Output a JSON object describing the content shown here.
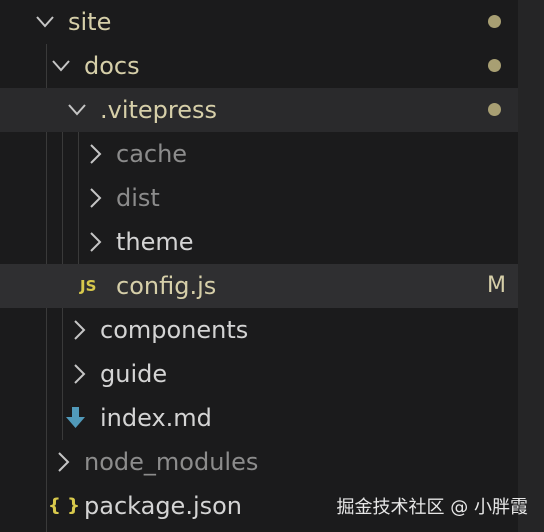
{
  "explorer": {
    "items": [
      {
        "label": "site",
        "type": "folder",
        "state": "expanded",
        "color": "#d6cfa9",
        "decoration": "dot"
      },
      {
        "label": "docs",
        "type": "folder",
        "state": "expanded",
        "color": "#d6cfa9",
        "decoration": "dot"
      },
      {
        "label": ".vitepress",
        "type": "folder",
        "state": "expanded",
        "color": "#d6cfa9",
        "decoration": "dot"
      },
      {
        "label": "cache",
        "type": "folder",
        "state": "collapsed",
        "color": "#8c8c8c"
      },
      {
        "label": "dist",
        "type": "folder",
        "state": "collapsed",
        "color": "#8c8c8c"
      },
      {
        "label": "theme",
        "type": "folder",
        "state": "collapsed",
        "color": "#d4d4d4"
      },
      {
        "label": "config.js",
        "type": "file",
        "icon": "JS",
        "icon_name": "javascript-file-icon",
        "color": "#d6cfa9",
        "badge": "M"
      },
      {
        "label": "components",
        "type": "folder",
        "state": "collapsed",
        "color": "#d4d4d4"
      },
      {
        "label": "guide",
        "type": "folder",
        "state": "collapsed",
        "color": "#d4d4d4"
      },
      {
        "label": "index.md",
        "type": "file",
        "icon_name": "markdown-file-icon",
        "color": "#d4d4d4"
      },
      {
        "label": "node_modules",
        "type": "folder",
        "state": "collapsed",
        "color": "#8c8c8c"
      },
      {
        "label": "package.json",
        "type": "file",
        "icon": "{ }",
        "icon_name": "json-file-icon",
        "color": "#d4d4d4"
      }
    ],
    "colors": {
      "modified": "#d6cfa9",
      "ignored": "#8c8c8c",
      "normal": "#d4d4d4",
      "dot": "#a89f73",
      "js_icon": "#d8c94c",
      "json_icon": "#d8c94c",
      "md_icon": "#519aba",
      "selected_row": "#2a2a2c"
    }
  },
  "watermark": "掘金技术社区 @ 小胖霞"
}
